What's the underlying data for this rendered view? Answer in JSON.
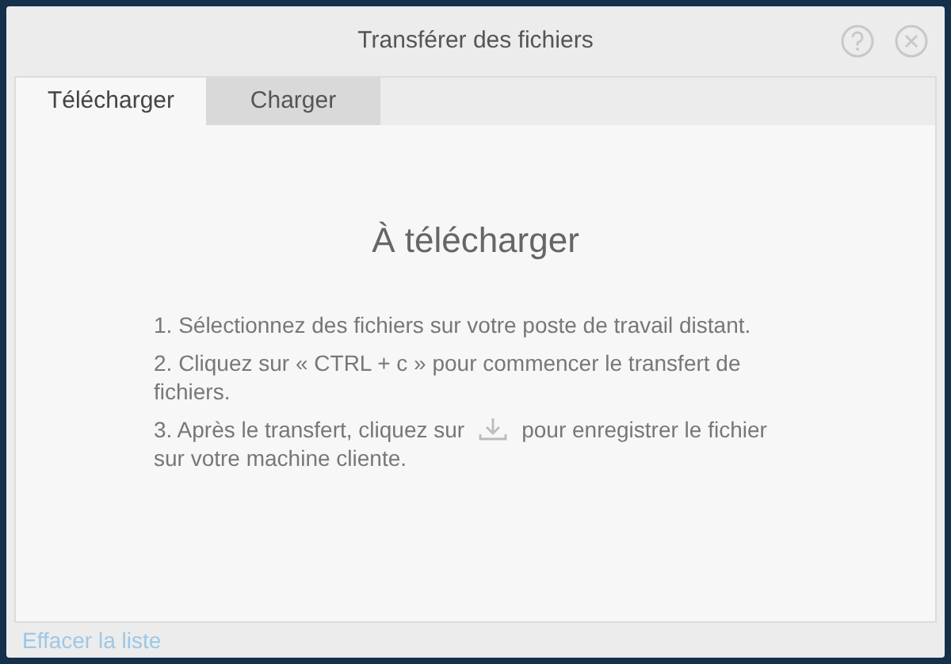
{
  "window": {
    "title": "Transférer des fichiers"
  },
  "tabs": [
    {
      "label": "Télécharger",
      "selected": true
    },
    {
      "label": "Charger",
      "selected": false
    }
  ],
  "panel": {
    "heading": "À télécharger",
    "steps": [
      {
        "kind": "text",
        "text": "1. Sélectionnez des fichiers sur votre poste de travail distant."
      },
      {
        "kind": "text",
        "text": "2. Cliquez sur « CTRL + c » pour commencer le transfert de fichiers."
      },
      {
        "kind": "icon",
        "text_before": "3. Après le transfert, cliquez sur",
        "text_after": "pour enregistrer le fichier",
        "text_continued": "sur votre machine cliente."
      }
    ]
  },
  "footer": {
    "link": "Effacer la liste"
  }
}
